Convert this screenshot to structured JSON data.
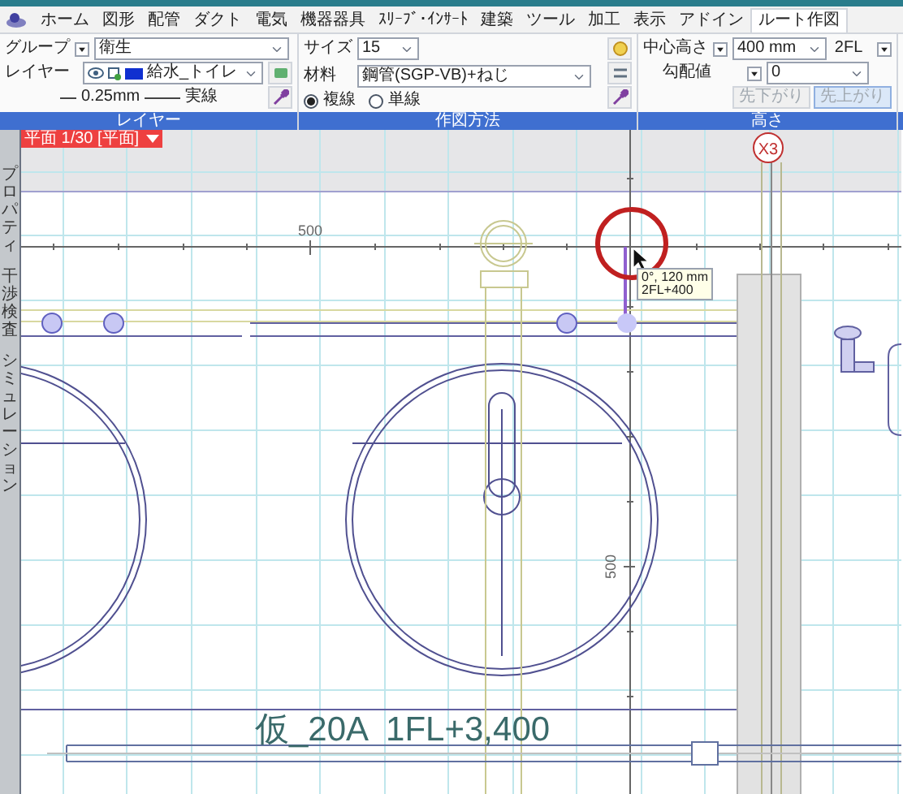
{
  "menu_tabs": [
    {
      "label": "ホーム",
      "selected": false
    },
    {
      "label": "図形",
      "selected": false
    },
    {
      "label": "配管",
      "selected": false
    },
    {
      "label": "ダクト",
      "selected": false
    },
    {
      "label": "電気",
      "selected": false
    },
    {
      "label": "機器器具",
      "selected": false
    },
    {
      "label": "ｽﾘｰﾌﾞ･ｲﾝｻｰﾄ",
      "selected": false
    },
    {
      "label": "建築",
      "selected": false
    },
    {
      "label": "ツール",
      "selected": false
    },
    {
      "label": "加工",
      "selected": false
    },
    {
      "label": "表示",
      "selected": false
    },
    {
      "label": "アドイン",
      "selected": false
    },
    {
      "label": "ルート作図",
      "selected": true
    }
  ],
  "layer_group": {
    "group_label": "グループ",
    "group_value": "衛生",
    "layer_label": "レイヤー",
    "layer_value": "給水_トイレ",
    "line_width": "0.25mm",
    "line_type": "実線",
    "title": "レイヤー"
  },
  "method_group": {
    "size_label": "サイズ",
    "size_value": "15",
    "material_label": "材料",
    "material_value": "鋼管(SGP-VB)+ねじ",
    "line_modes": [
      {
        "label": "複線",
        "selected": true
      },
      {
        "label": "単線",
        "selected": false
      }
    ],
    "title": "作図方法"
  },
  "height_group": {
    "center_label": "中心高さ",
    "center_value": "400 mm",
    "floor_value": "2FL",
    "slope_label": "勾配値",
    "slope_value": "0",
    "buttons": [
      {
        "label": "先下がり",
        "selected": false
      },
      {
        "label": "先上がり",
        "selected": true
      }
    ],
    "title": "高さ"
  },
  "side_tabs": [
    "プロパティ",
    "干渉検査",
    "シミュレーション"
  ],
  "view_tab": "平面 1/30 [平面]",
  "canvas": {
    "ruler_h": "500",
    "ruler_v": "500",
    "grid_label": "X3",
    "tooltip": [
      "0°, 120 mm",
      "2FL+400"
    ],
    "pipe_label": "仮_20A  1FL+3,400"
  }
}
